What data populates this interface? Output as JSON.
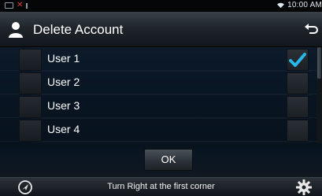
{
  "status_bar": {
    "time": "10:00 AM"
  },
  "header": {
    "title": "Delete Account"
  },
  "users": [
    {
      "label": "User 1",
      "checked": true
    },
    {
      "label": "User 2",
      "checked": false
    },
    {
      "label": "User 3",
      "checked": false
    },
    {
      "label": "User 4",
      "checked": false
    }
  ],
  "actions": {
    "ok_label": "OK"
  },
  "bottom_bar": {
    "nav_text": "Turn Right at the first corner"
  },
  "colors": {
    "accent_check": "#29b6e8",
    "background": "#0b0f14"
  }
}
